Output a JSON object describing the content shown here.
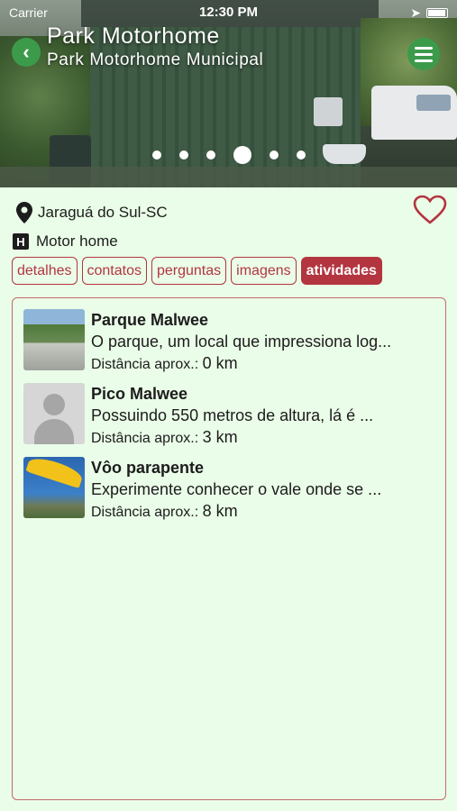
{
  "status": {
    "carrier": "Carrier",
    "time": "12:30 PM"
  },
  "header": {
    "title": "Park Motorhome",
    "subtitle": "Park Motorhome Municipal"
  },
  "carousel": {
    "count": 6,
    "active": 4
  },
  "info": {
    "location": "Jaraguá do Sul-SC",
    "type": "Motor home"
  },
  "tabs": [
    {
      "label": "detalhes"
    },
    {
      "label": "contatos"
    },
    {
      "label": "perguntas"
    },
    {
      "label": "imagens"
    },
    {
      "label": "atividades"
    }
  ],
  "activities": [
    {
      "name": "Parque Malwee",
      "desc": "O parque, um local que impressiona log...",
      "dist_label": "Distância aprox.:",
      "dist_value": "0 km"
    },
    {
      "name": "Pico Malwee",
      "desc": "Possuindo 550 metros de altura, lá é ...",
      "dist_label": "Distância aprox.:",
      "dist_value": "3 km"
    },
    {
      "name": "Vôo parapente",
      "desc": "Experimente conhecer o vale onde se ...",
      "dist_label": "Distância aprox.:",
      "dist_value": "8 km"
    }
  ],
  "colors": {
    "accent": "#b3353f",
    "green": "#3c9b4b",
    "background": "#eafde8"
  }
}
